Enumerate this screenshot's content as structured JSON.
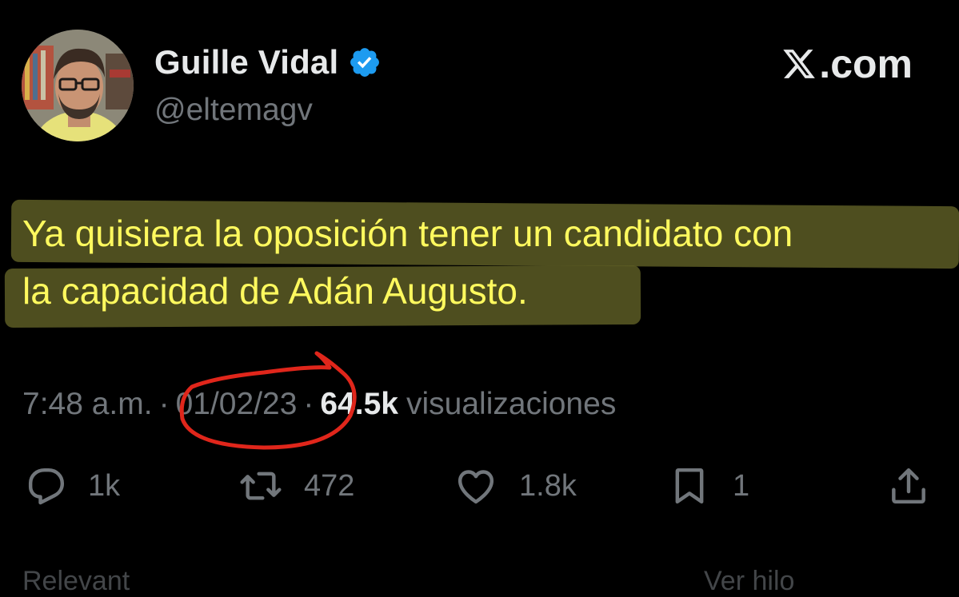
{
  "author": {
    "display_name": "Guille Vidal",
    "handle": "@eltemagv",
    "verified_icon": "verified-badge-icon",
    "badge_color": "#1d9bf0"
  },
  "brand": {
    "label": ".com",
    "icon": "x-logo-icon"
  },
  "tweet": {
    "lines": [
      "Ya quisiera la oposición tener un candidato con",
      "la capacidad de Adán Augusto."
    ],
    "highlight_color": "#5c5c24",
    "text_color": "#fff95e"
  },
  "meta": {
    "time": "7:48 a.m.",
    "separator": "·",
    "date": "01/02/23",
    "views_count": "64.5k",
    "views_label": "visualizaciones",
    "annotation_color": "#e0261b"
  },
  "actions": {
    "reply": {
      "icon": "reply-icon",
      "count": "1k"
    },
    "repost": {
      "icon": "repost-icon",
      "count": "472"
    },
    "like": {
      "icon": "heart-icon",
      "count": "1.8k"
    },
    "bookmark": {
      "icon": "bookmark-icon",
      "count": "1"
    },
    "share": {
      "icon": "share-icon"
    }
  },
  "footer": {
    "left": "Relevant",
    "right": "Ver hilo"
  }
}
